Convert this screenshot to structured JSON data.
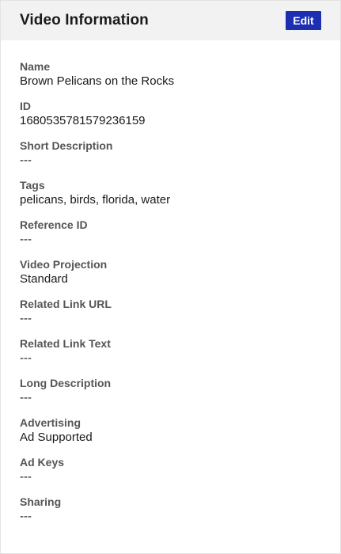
{
  "header": {
    "title": "Video Information",
    "edit_label": "Edit"
  },
  "fields": [
    {
      "label": "Name",
      "value": "Brown Pelicans on the Rocks"
    },
    {
      "label": "ID",
      "value": "1680535781579236159"
    },
    {
      "label": "Short Description",
      "value": "---"
    },
    {
      "label": "Tags",
      "value": "pelicans, birds, florida, water"
    },
    {
      "label": "Reference ID",
      "value": "---"
    },
    {
      "label": "Video Projection",
      "value": "Standard"
    },
    {
      "label": "Related Link URL",
      "value": "---"
    },
    {
      "label": "Related Link Text",
      "value": "---"
    },
    {
      "label": "Long Description",
      "value": "---"
    },
    {
      "label": "Advertising",
      "value": "Ad Supported"
    },
    {
      "label": "Ad Keys",
      "value": "---"
    },
    {
      "label": "Sharing",
      "value": "---"
    }
  ],
  "colors": {
    "accent": "#1c2fb3",
    "header_bg": "#f2f2f2",
    "label": "#555555",
    "value": "#1a1a1a"
  }
}
